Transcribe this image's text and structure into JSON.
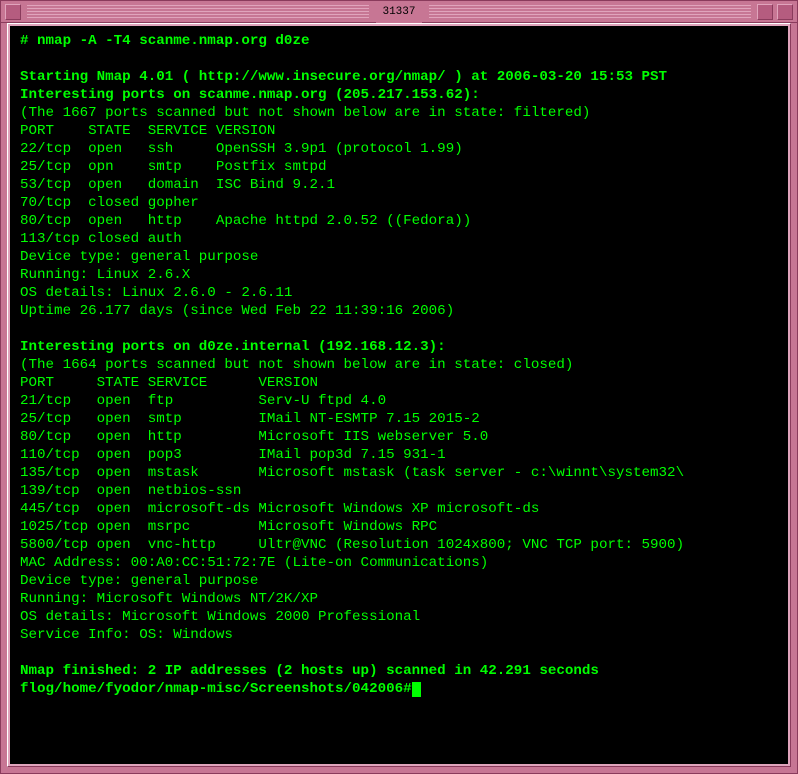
{
  "window": {
    "title": "31337"
  },
  "term": {
    "command": "# nmap -A -T4 scanme.nmap.org d0ze",
    "start_line": "Starting Nmap 4.01 ( http://www.insecure.org/nmap/ ) at 2006-03-20 15:53 PST",
    "host1_intro": "Interesting ports on scanme.nmap.org (205.217.153.62):",
    "host1_filtered": "(The 1667 ports scanned but not shown below are in state: filtered)",
    "host1_header": "PORT    STATE  SERVICE VERSION",
    "host1_ports": [
      "22/tcp  open   ssh     OpenSSH 3.9p1 (protocol 1.99)",
      "25/tcp  opn    smtp    Postfix smtpd",
      "53/tcp  open   domain  ISC Bind 9.2.1",
      "70/tcp  closed gopher",
      "80/tcp  open   http    Apache httpd 2.0.52 ((Fedora))",
      "113/tcp closed auth"
    ],
    "host1_meta": [
      "Device type: general purpose",
      "Running: Linux 2.6.X",
      "OS details: Linux 2.6.0 - 2.6.11",
      "Uptime 26.177 days (since Wed Feb 22 11:39:16 2006)"
    ],
    "host2_intro": "Interesting ports on d0ze.internal (192.168.12.3):",
    "host2_filtered": "(The 1664 ports scanned but not shown below are in state: closed)",
    "host2_header": "PORT     STATE SERVICE      VERSION",
    "host2_ports": [
      "21/tcp   open  ftp          Serv-U ftpd 4.0",
      "25/tcp   open  smtp         IMail NT-ESMTP 7.15 2015-2",
      "80/tcp   open  http         Microsoft IIS webserver 5.0",
      "110/tcp  open  pop3         IMail pop3d 7.15 931-1",
      "135/tcp  open  mstask       Microsoft mstask (task server - c:\\winnt\\system32\\",
      "139/tcp  open  netbios-ssn",
      "445/tcp  open  microsoft-ds Microsoft Windows XP microsoft-ds",
      "1025/tcp open  msrpc        Microsoft Windows RPC",
      "5800/tcp open  vnc-http     Ultr@VNC (Resolution 1024x800; VNC TCP port: 5900)"
    ],
    "host2_meta": [
      "MAC Address: 00:A0:CC:51:72:7E (Lite-on Communications)",
      "Device type: general purpose",
      "Running: Microsoft Windows NT/2K/XP",
      "OS details: Microsoft Windows 2000 Professional",
      "Service Info: OS: Windows"
    ],
    "finished": "Nmap finished: 2 IP addresses (2 hosts up) scanned in 42.291 seconds",
    "prompt": "flog/home/fyodor/nmap-misc/Screenshots/042006#"
  },
  "chart_data": {
    "type": "table",
    "hosts": [
      {
        "name": "scanme.nmap.org",
        "ip": "205.217.153.62",
        "filtered_state": "filtered",
        "scanned_not_shown": 1667,
        "device_type": "general purpose",
        "running": "Linux 2.6.X",
        "os_details": "Linux 2.6.0 - 2.6.11",
        "uptime_days": 26.177,
        "uptime_since": "Wed Feb 22 11:39:16 2006",
        "columns": [
          "PORT",
          "STATE",
          "SERVICE",
          "VERSION"
        ],
        "rows": [
          {
            "port": "22/tcp",
            "state": "open",
            "service": "ssh",
            "version": "OpenSSH 3.9p1 (protocol 1.99)"
          },
          {
            "port": "25/tcp",
            "state": "opn",
            "service": "smtp",
            "version": "Postfix smtpd"
          },
          {
            "port": "53/tcp",
            "state": "open",
            "service": "domain",
            "version": "ISC Bind 9.2.1"
          },
          {
            "port": "70/tcp",
            "state": "closed",
            "service": "gopher",
            "version": ""
          },
          {
            "port": "80/tcp",
            "state": "open",
            "service": "http",
            "version": "Apache httpd 2.0.52 ((Fedora))"
          },
          {
            "port": "113/tcp",
            "state": "closed",
            "service": "auth",
            "version": ""
          }
        ]
      },
      {
        "name": "d0ze.internal",
        "ip": "192.168.12.3",
        "filtered_state": "closed",
        "scanned_not_shown": 1664,
        "mac_address": "00:A0:CC:51:72:7E",
        "mac_vendor": "Lite-on Communications",
        "device_type": "general purpose",
        "running": "Microsoft Windows NT/2K/XP",
        "os_details": "Microsoft Windows 2000 Professional",
        "service_info_os": "Windows",
        "columns": [
          "PORT",
          "STATE",
          "SERVICE",
          "VERSION"
        ],
        "rows": [
          {
            "port": "21/tcp",
            "state": "open",
            "service": "ftp",
            "version": "Serv-U ftpd 4.0"
          },
          {
            "port": "25/tcp",
            "state": "open",
            "service": "smtp",
            "version": "IMail NT-ESMTP 7.15 2015-2"
          },
          {
            "port": "80/tcp",
            "state": "open",
            "service": "http",
            "version": "Microsoft IIS webserver 5.0"
          },
          {
            "port": "110/tcp",
            "state": "open",
            "service": "pop3",
            "version": "IMail pop3d 7.15 931-1"
          },
          {
            "port": "135/tcp",
            "state": "open",
            "service": "mstask",
            "version": "Microsoft mstask (task server - c:\\winnt\\system32\\"
          },
          {
            "port": "139/tcp",
            "state": "open",
            "service": "netbios-ssn",
            "version": ""
          },
          {
            "port": "445/tcp",
            "state": "open",
            "service": "microsoft-ds",
            "version": "Microsoft Windows XP microsoft-ds"
          },
          {
            "port": "1025/tcp",
            "state": "open",
            "service": "msrpc",
            "version": "Microsoft Windows RPC"
          },
          {
            "port": "5800/tcp",
            "state": "open",
            "service": "vnc-http",
            "version": "Ultr@VNC (Resolution 1024x800; VNC TCP port: 5900)"
          }
        ]
      }
    ],
    "scan_summary": {
      "ip_addresses": 2,
      "hosts_up": 2,
      "seconds": 42.291,
      "started_at": "2006-03-20 15:53 PST",
      "nmap_version": "4.01"
    }
  }
}
